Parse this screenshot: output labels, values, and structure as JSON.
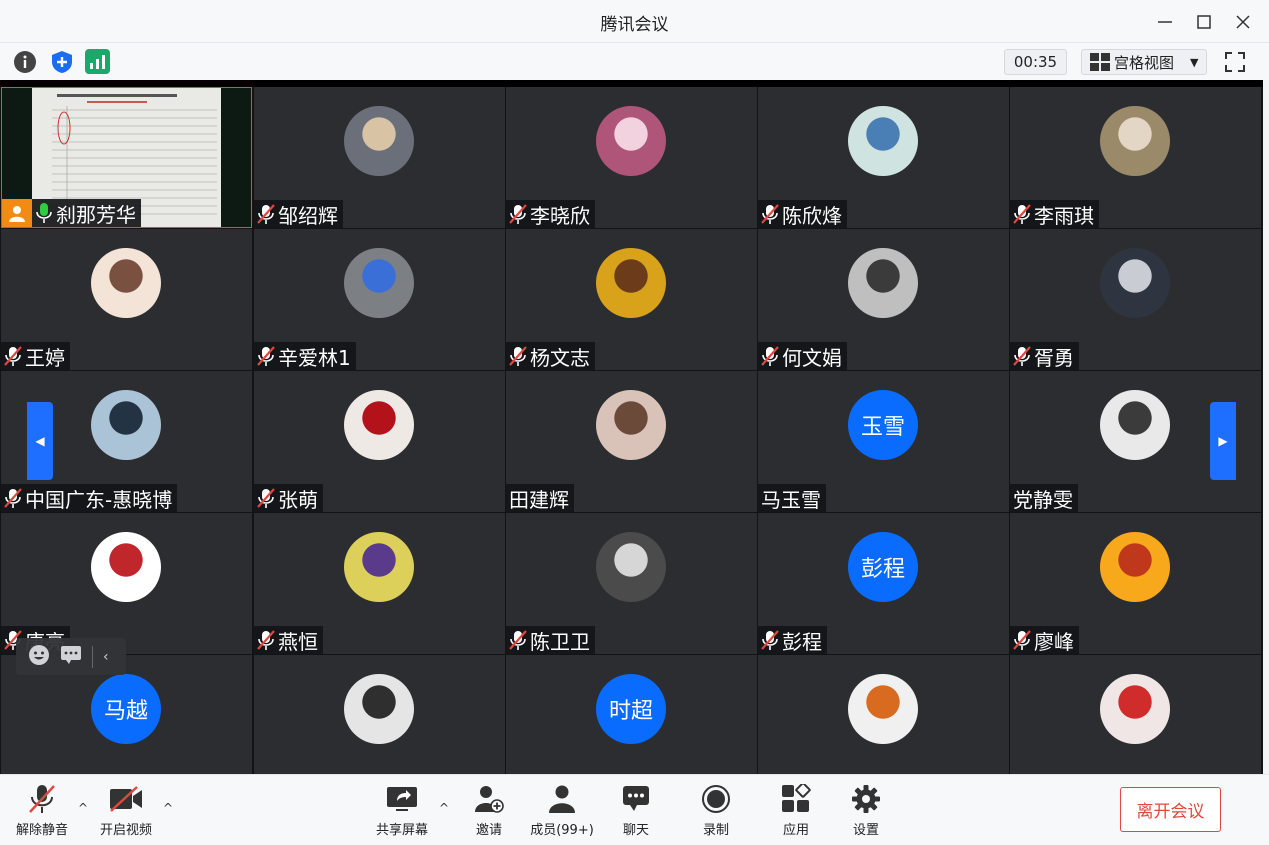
{
  "window": {
    "title": "腾讯会议"
  },
  "toolbar": {
    "timer": "00:35",
    "view_label": "宫格视图"
  },
  "shared_tile": {
    "name": "刹那芳华"
  },
  "participants": [
    {
      "name": "邹绍辉",
      "avatar": "photo"
    },
    {
      "name": "李晓欣",
      "avatar": "photo"
    },
    {
      "name": "陈欣烽",
      "avatar": "photo"
    },
    {
      "name": "李雨琪",
      "avatar": "photo"
    },
    {
      "name": "王婷",
      "avatar": "photo"
    },
    {
      "name": "辛爱林1",
      "avatar": "photo"
    },
    {
      "name": "杨文志",
      "avatar": "photo"
    },
    {
      "name": "何文娟",
      "avatar": "photo"
    },
    {
      "name": "胥勇",
      "avatar": "photo"
    },
    {
      "name": "中国广东-惠晓博",
      "avatar": "photo"
    },
    {
      "name": "张萌",
      "avatar": "photo"
    },
    {
      "name": "田建辉",
      "avatar": "photo"
    },
    {
      "name": "马玉雪",
      "avatar_text": "玉雪"
    },
    {
      "name": "党静雯",
      "avatar": "photo"
    },
    {
      "name": "唐亮",
      "avatar": "photo"
    },
    {
      "name": "燕恒",
      "avatar": "photo"
    },
    {
      "name": "陈卫卫",
      "avatar": "photo"
    },
    {
      "name": "彭程",
      "avatar_text": "彭程"
    },
    {
      "name": "廖峰",
      "avatar": "photo"
    },
    {
      "avatar_text": "马越"
    },
    {
      "avatar": "photo"
    },
    {
      "avatar_text": "时超"
    },
    {
      "avatar": "photo"
    },
    {
      "avatar": "photo"
    }
  ],
  "bottom": {
    "unmute": "解除静音",
    "start_video": "开启视频",
    "share_screen": "共享屏幕",
    "invite": "邀请",
    "members": "成员(99+)",
    "chat": "聊天",
    "record": "录制",
    "apps": "应用",
    "settings": "设置",
    "leave": "离开会议"
  },
  "colors": {
    "accent": "#0a6cff",
    "leave": "#e0473f",
    "tile_bg": "#2b2d31"
  }
}
